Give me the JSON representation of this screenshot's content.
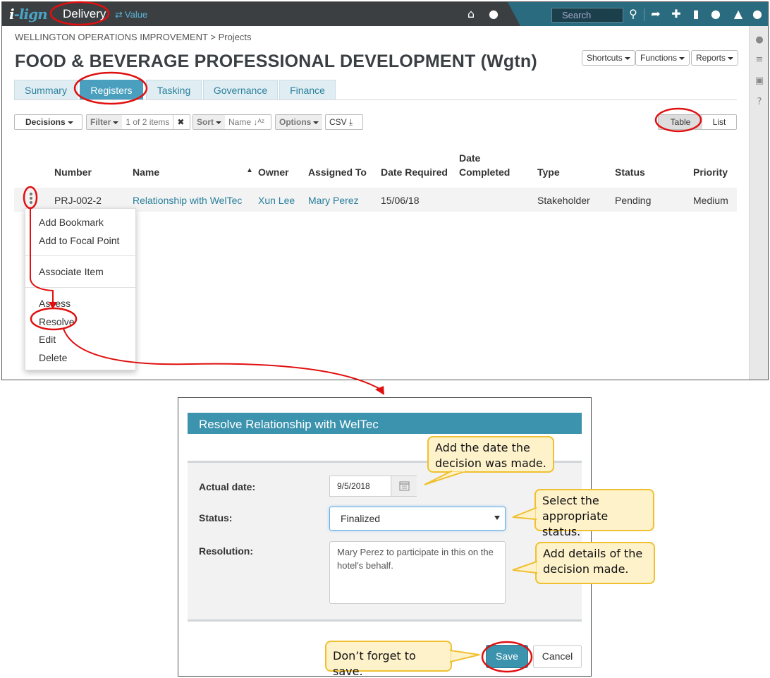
{
  "topbar": {
    "logo": "i-lign",
    "module": "Delivery",
    "value_link": "Value",
    "search_placeholder": "Search"
  },
  "breadcrumb": "WELLINGTON OPERATIONS IMPROVEMENT > Projects",
  "page_title": "FOOD & BEVERAGE PROFESSIONAL DEVELOPMENT (Wgtn)",
  "header_buttons": {
    "shortcuts": "Shortcuts",
    "functions": "Functions",
    "reports": "Reports"
  },
  "tabs": [
    {
      "label": "Summary"
    },
    {
      "label": "Registers",
      "active": true
    },
    {
      "label": "Tasking"
    },
    {
      "label": "Governance"
    },
    {
      "label": "Finance"
    }
  ],
  "toolbar": {
    "decisions": "Decisions",
    "filter": "Filter",
    "filter_count": "1 of 2 items",
    "sort": "Sort",
    "sort_field": "Name",
    "options": "Options",
    "csv": "CSV",
    "table": "Table",
    "list": "List"
  },
  "table": {
    "columns": [
      "Number",
      "Name",
      "Owner",
      "Assigned To",
      "Date Required",
      "Date Completed",
      "Type",
      "Status",
      "Priority"
    ],
    "date_completed_line1": "Date",
    "date_completed_line2": "Completed",
    "rows": [
      {
        "number": "PRJ-002-2",
        "name": "Relationship with WelTec",
        "owner": "Xun Lee",
        "assigned_to": "Mary Perez",
        "date_required": "15/06/18",
        "date_completed": "",
        "type": "Stakeholder",
        "status": "Pending",
        "priority": "Medium"
      }
    ]
  },
  "context_menu": {
    "add_bookmark": "Add Bookmark",
    "add_focal": "Add to Focal Point",
    "associate": "Associate Item",
    "assess": "Assess",
    "resolve": "Resolve",
    "edit": "Edit",
    "delete": "Delete"
  },
  "dialog": {
    "title": "Resolve Relationship with WelTec",
    "actual_date_label": "Actual date:",
    "actual_date_value": "9/5/2018",
    "status_label": "Status:",
    "status_value": "Finalized",
    "resolution_label": "Resolution:",
    "resolution_value": "Mary Perez to participate in this on the hotel's behalf.",
    "save": "Save",
    "cancel": "Cancel"
  },
  "callouts": {
    "date": "Add the date the decision was made.",
    "status": "Select the appropriate status.",
    "details": "Add details of the decision made.",
    "save": "Don’t forget to save."
  },
  "colors": {
    "accent": "#3c93ad",
    "highlight_ring": "#e01010",
    "callout_fill": "#fef2cb",
    "callout_border": "#f0c030"
  }
}
